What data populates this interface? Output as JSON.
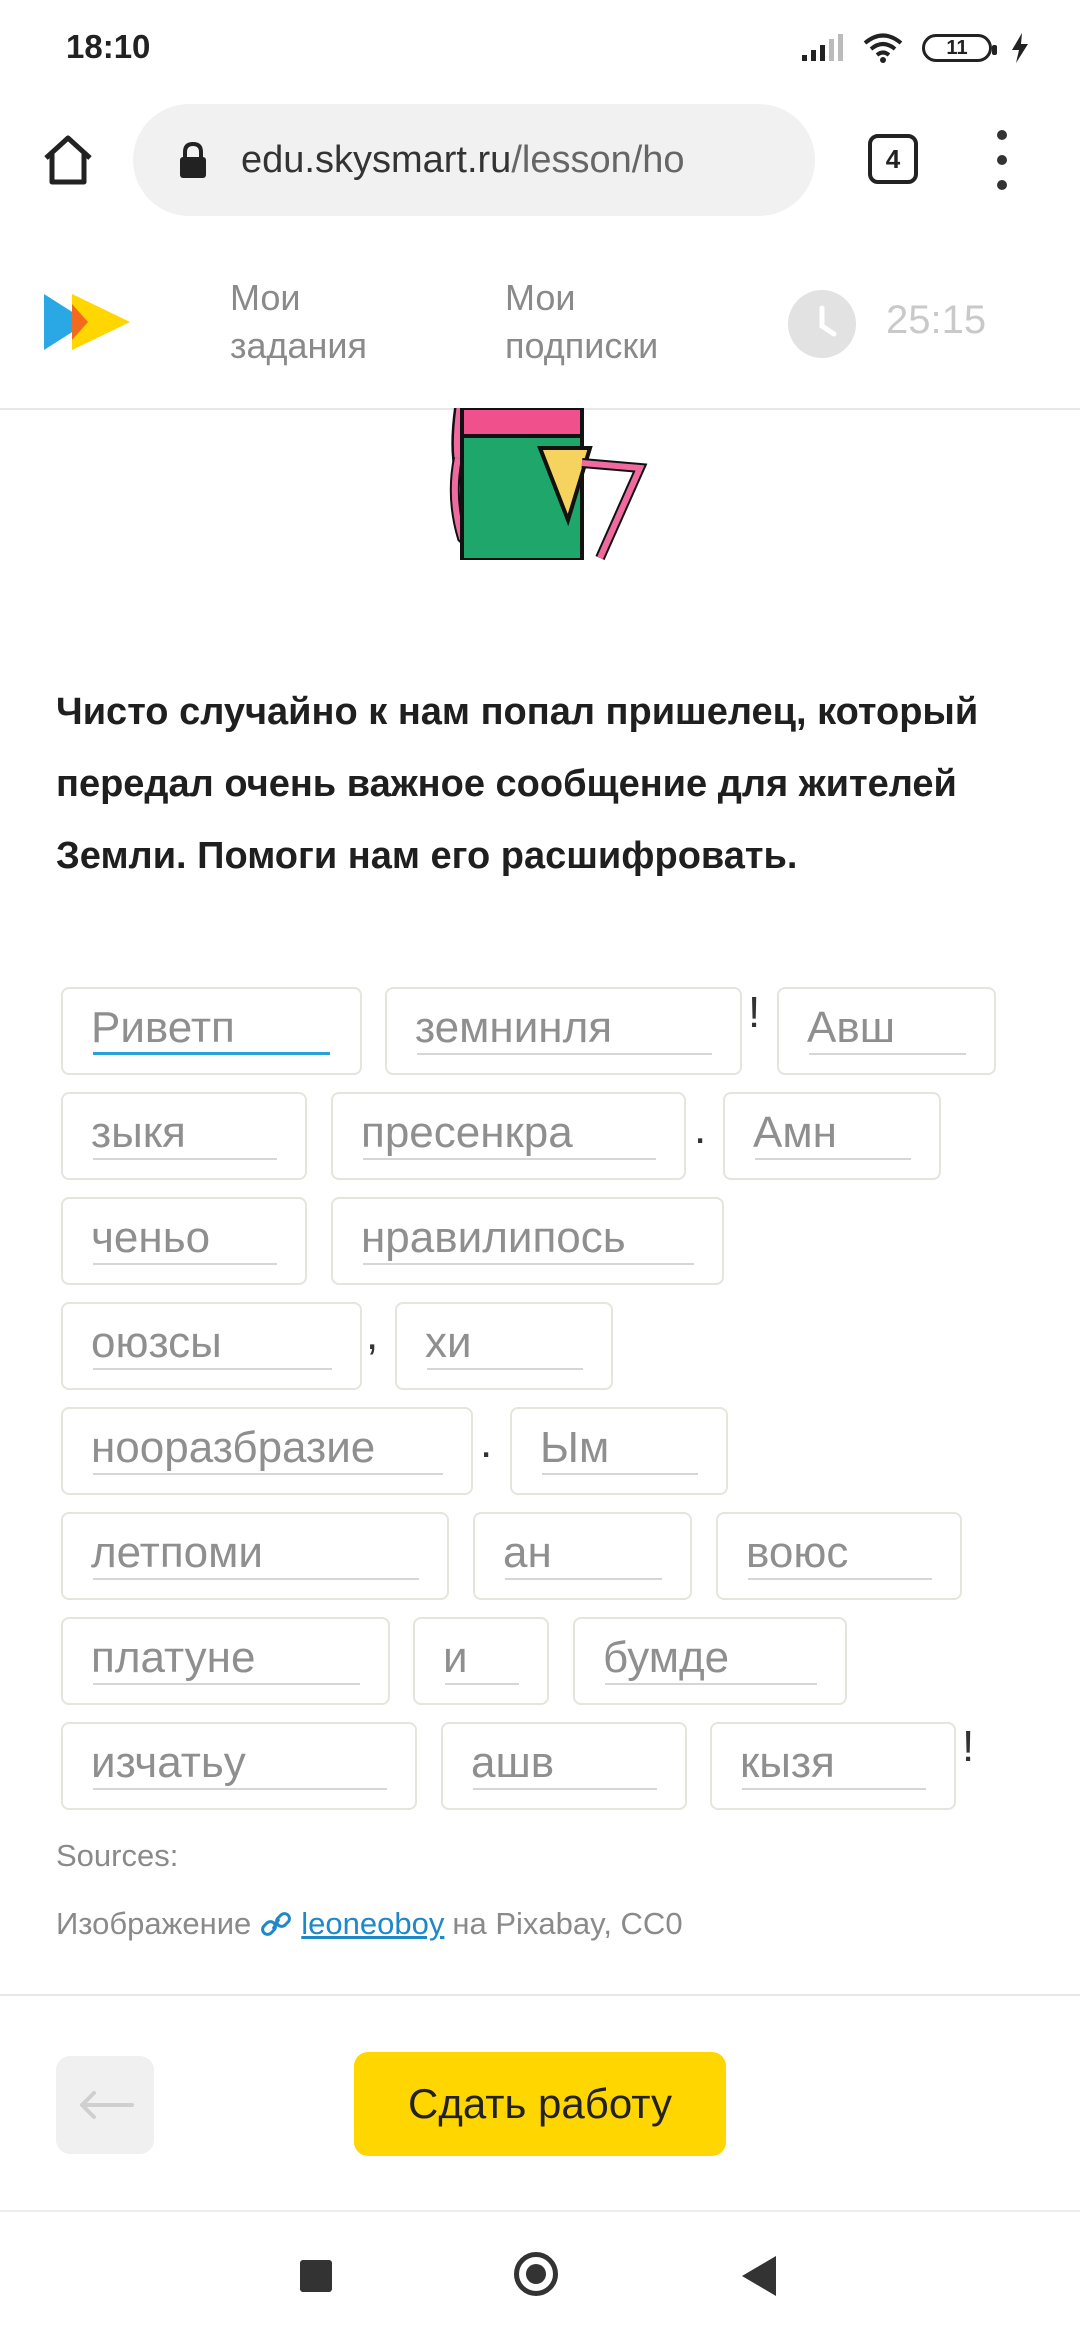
{
  "status_bar": {
    "time": "18:10",
    "battery": "11"
  },
  "browser": {
    "url_domain": "edu.skysmart.ru",
    "url_path": "/lesson/ho",
    "tab_count": "4"
  },
  "site_header": {
    "nav_tasks": "Мои\nзадания",
    "nav_subscriptions": "Мои\nподписки",
    "timer": "25:15"
  },
  "task": {
    "text": "Чисто случайно к нам попал пришелец, который передал очень важное сообщение для жителей Земли. Помоги нам его расшифровать."
  },
  "words": [
    "Риветп",
    "земнинля",
    "Авш",
    "зыкя",
    "пресенкра",
    "Амн",
    "ченьо",
    "нравилипось",
    "оюзсы",
    "хи",
    "нооразбразие",
    "Ым",
    "летпоми",
    "ан",
    "воюс",
    "платуне",
    "и",
    "бумде",
    "изчатьу",
    "ашв",
    "кызя"
  ],
  "punctuation": {
    "p1": "!",
    "p2": ".",
    "p3": ",",
    "p4": ".",
    "p5": "!"
  },
  "sources": {
    "label": "Sources:",
    "prefix": "Изображение",
    "author": "leoneoboy",
    "suffix": "на Pixabay, CC0"
  },
  "footer": {
    "submit_label": "Сдать работу"
  },
  "colors": {
    "accent": "#ffd600",
    "link": "#1e88c8",
    "active_underline": "#2aa0d8"
  }
}
